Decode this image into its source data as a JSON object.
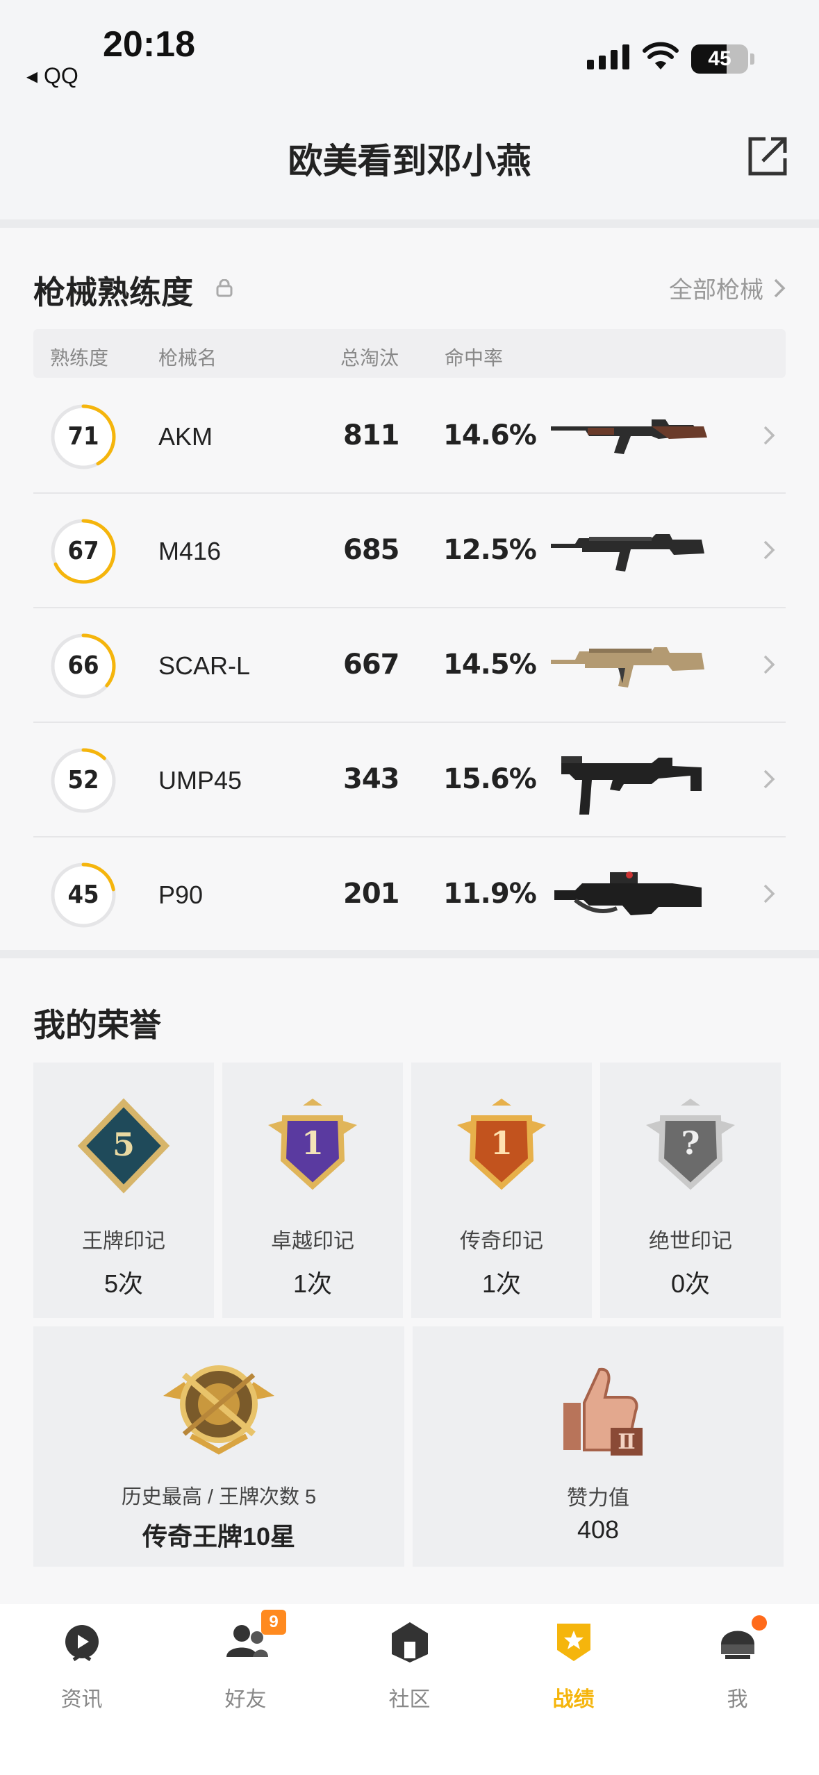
{
  "status_bar": {
    "time": "20:18",
    "back_app": "◂ QQ",
    "battery": "45"
  },
  "header": {
    "title": "欧美看到邓小燕"
  },
  "weapons": {
    "title": "枪械熟练度",
    "all_label": "全部枪械",
    "columns": [
      "熟练度",
      "枪械名",
      "总淘汰",
      "命中率"
    ],
    "rows": [
      {
        "level": "71",
        "name": "AKM",
        "kills": "811",
        "accuracy": "14.6%",
        "progress": 0.42
      },
      {
        "level": "67",
        "name": "M416",
        "kills": "685",
        "accuracy": "12.5%",
        "progress": 0.68
      },
      {
        "level": "66",
        "name": "SCAR-L",
        "kills": "667",
        "accuracy": "14.5%",
        "progress": 0.36
      },
      {
        "level": "52",
        "name": "UMP45",
        "kills": "343",
        "accuracy": "15.6%",
        "progress": 0.12
      },
      {
        "level": "45",
        "name": "P90",
        "kills": "201",
        "accuracy": "11.9%",
        "progress": 0.22
      }
    ]
  },
  "honors": {
    "title": "我的荣誉",
    "marks": [
      {
        "label": "王牌印记",
        "value": "5次",
        "icon": "ace-mark-icon",
        "digit": "5"
      },
      {
        "label": "卓越印记",
        "value": "1次",
        "icon": "excellence-mark-icon",
        "digit": "1"
      },
      {
        "label": "传奇印记",
        "value": "1次",
        "icon": "legend-mark-icon",
        "digit": "1"
      },
      {
        "label": "绝世印记",
        "value": "0次",
        "icon": "peerless-mark-icon",
        "digit": "?"
      }
    ],
    "highest": {
      "label": "历史最高 / 王牌次数 5",
      "value": "传奇王牌10星"
    },
    "likes": {
      "label": "赞力值",
      "value": "408"
    }
  },
  "tabbar": {
    "tabs": [
      {
        "label": "资讯",
        "icon": "news-icon"
      },
      {
        "label": "好友",
        "icon": "friends-icon",
        "badge": "9"
      },
      {
        "label": "社区",
        "icon": "community-icon"
      },
      {
        "label": "战绩",
        "icon": "record-icon",
        "active": true
      },
      {
        "label": "我",
        "icon": "profile-icon"
      }
    ]
  },
  "colors": {
    "accent": "#f5b50c",
    "badge": "#ff8a1f",
    "ring_track": "#e5e5e7"
  }
}
